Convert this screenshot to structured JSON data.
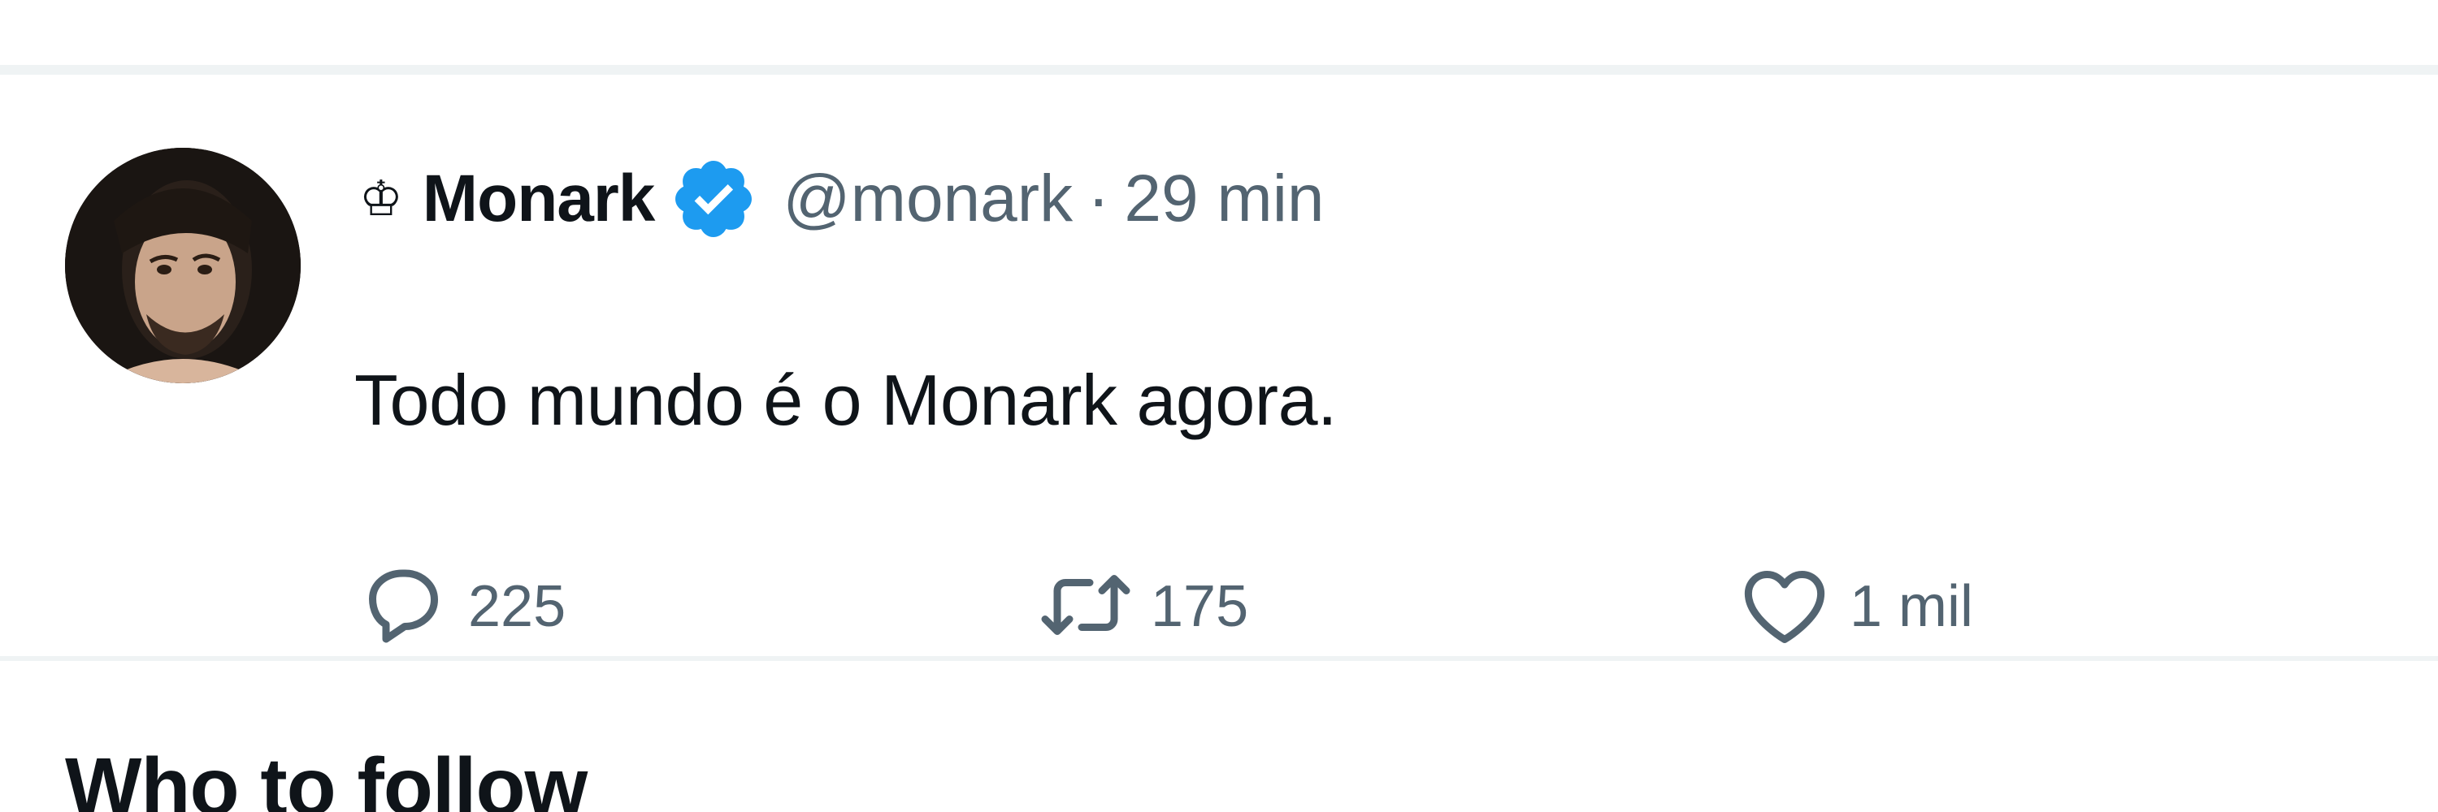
{
  "tweet": {
    "display_name": "Monark",
    "name_prefix_icon": "crown-icon",
    "verified": true,
    "handle": "@monark",
    "separator": "·",
    "time": "29 min",
    "text": "Todo mundo é o Monark agora.",
    "reply_count": "225",
    "retweet_count": "175",
    "like_count": "1 mil"
  },
  "sidebar_section": {
    "title": "Who to follow"
  },
  "colors": {
    "verified_badge": "#1d9bf0",
    "secondary_text": "#536471",
    "primary_text": "#0f1419",
    "divider": "#eff3f4"
  }
}
